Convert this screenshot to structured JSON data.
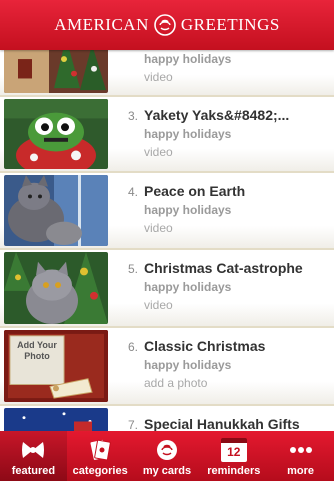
{
  "header": {
    "brand_left": "AMERICAN",
    "brand_right": "GREETINGS",
    "logo_icon": "rose-icon"
  },
  "list": {
    "items": [
      {
        "number": "",
        "title": "",
        "subtitle": "happy holidays",
        "type": "video",
        "thumb": "gingerbread-house-image"
      },
      {
        "number": "3.",
        "title": "Yakety Yaks&#8482;...",
        "subtitle": "happy holidays",
        "type": "video",
        "thumb": "yak-sweater-image"
      },
      {
        "number": "4.",
        "title": "Peace on Earth",
        "subtitle": "happy holidays",
        "type": "video",
        "thumb": "cat-window-image"
      },
      {
        "number": "5.",
        "title": "Christmas Cat-astrophe",
        "subtitle": "happy holidays",
        "type": "video",
        "thumb": "cat-tree-image"
      },
      {
        "number": "6.",
        "title": "Classic Christmas",
        "subtitle": "happy holidays",
        "type": "add a photo",
        "thumb": "photo-frame-image",
        "thumb_text": "Add Your Photo"
      },
      {
        "number": "7.",
        "title": "Special Hanukkah Gifts",
        "subtitle": "",
        "type": "",
        "thumb": "hanukkah-image"
      }
    ]
  },
  "tabbar": {
    "tabs": [
      {
        "label": "featured",
        "icon": "bow-icon",
        "active": true
      },
      {
        "label": "categories",
        "icon": "cards-icon",
        "active": false
      },
      {
        "label": "my cards",
        "icon": "rose-icon",
        "active": false
      },
      {
        "label": "reminders",
        "icon": "calendar-icon",
        "calendar_day": "12",
        "active": false
      },
      {
        "label": "more",
        "icon": "more-dots-icon",
        "active": false
      }
    ]
  },
  "colors": {
    "brand_red": "#d0142a",
    "title_text": "#333333",
    "sub_text": "#9a9a9a"
  }
}
